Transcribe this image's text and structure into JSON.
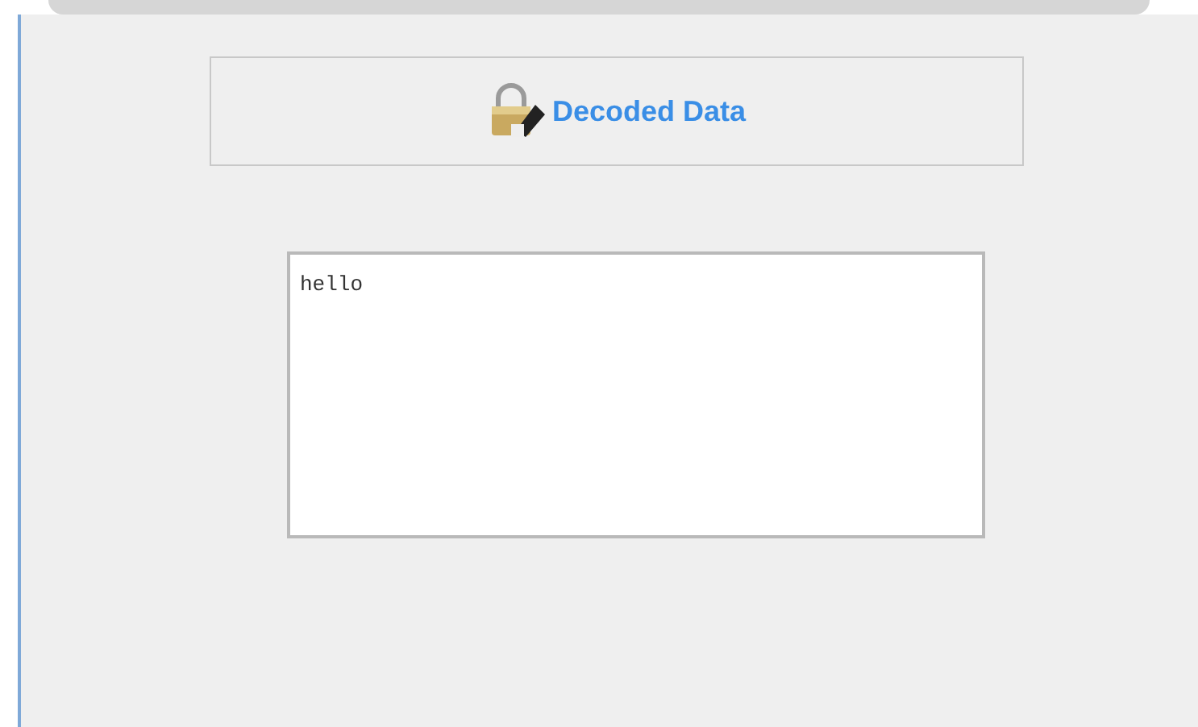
{
  "header": {
    "title": "Decoded Data"
  },
  "output": {
    "value": "hello"
  }
}
